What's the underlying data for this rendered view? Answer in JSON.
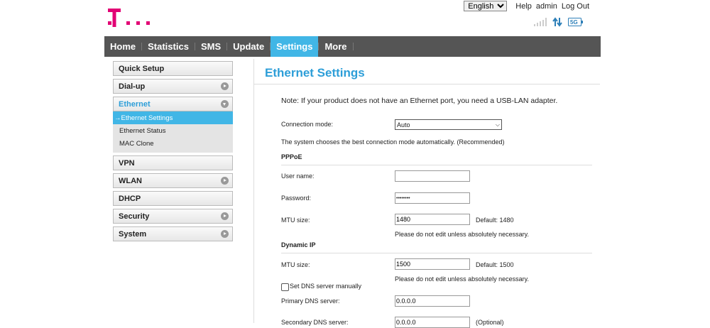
{
  "topbar": {
    "language": "English",
    "help": "Help",
    "admin": "admin",
    "logout": "Log Out"
  },
  "colors": {
    "brand": "#e20074",
    "accent": "#41b6e6",
    "nav_bg": "#555555"
  },
  "nav": {
    "items": [
      "Home",
      "Statistics",
      "SMS",
      "Update",
      "Settings",
      "More"
    ],
    "active": "Settings"
  },
  "sidebar": {
    "quick_setup": "Quick Setup",
    "dialup": "Dial-up",
    "ethernet": "Ethernet",
    "ethernet_sub": [
      "Ethernet Settings",
      "Ethernet Status",
      "MAC Clone"
    ],
    "vpn": "VPN",
    "wlan": "WLAN",
    "dhcp": "DHCP",
    "security": "Security",
    "system": "System"
  },
  "main": {
    "title": "Ethernet Settings",
    "note": "Note: If your product does not have an Ethernet port, you need a USB-LAN adapter.",
    "connection_mode_label": "Connection mode:",
    "connection_mode_value": "Auto",
    "connection_mode_desc": "The system chooses the best connection mode automatically. (Recommended)",
    "pppoe": {
      "heading": "PPPoE",
      "username_label": "User name:",
      "username_value": "",
      "password_label": "Password:",
      "password_value": "••••••••",
      "mtu_label": "MTU size:",
      "mtu_value": "1480",
      "mtu_default": "Default: 1480",
      "mtu_warning": "Please do not edit unless absolutely necessary."
    },
    "dynamic_ip": {
      "heading": "Dynamic IP",
      "mtu_label": "MTU size:",
      "mtu_value": "1500",
      "mtu_default": "Default: 1500",
      "mtu_warning": "Please do not edit unless absolutely necessary.",
      "dns_checkbox_label": "Set DNS server manually",
      "primary_dns_label": "Primary DNS server:",
      "primary_dns_value": "0.0.0.0",
      "secondary_dns_label": "Secondary DNS server:",
      "secondary_dns_value": "0.0.0.0",
      "secondary_optional": "(Optional)"
    }
  },
  "icons": {
    "signal": "signal-bars-icon",
    "data": "up-down-arrows-icon",
    "network": "5g-icon"
  }
}
